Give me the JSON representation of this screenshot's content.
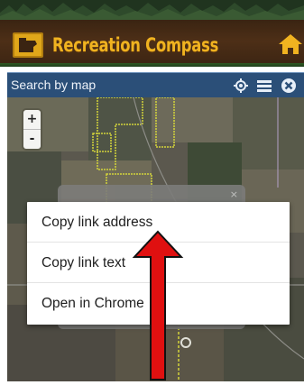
{
  "header": {
    "app_title": "Recreation Compass",
    "logo_icon": "minnesota-state-logo-icon",
    "home_icon": "home-icon",
    "colors": {
      "title": "#f0b320",
      "banner": "#4d2f17",
      "accent_green": "#2f5a24"
    }
  },
  "map_panel": {
    "title": "Search by map",
    "toolbar_icons": [
      "locate-icon",
      "menu-icon",
      "close-icon"
    ],
    "zoom_in_label": "+",
    "zoom_out_label": "-",
    "bar_color": "#2b4f78"
  },
  "background_popup": {
    "close_label": "×"
  },
  "context_menu": {
    "items": [
      {
        "label": "Copy link address"
      },
      {
        "label": "Copy link text"
      },
      {
        "label": "Open in Chrome"
      }
    ]
  },
  "annotation": {
    "arrow_color": "#e01010",
    "arrow_direction": "up"
  }
}
